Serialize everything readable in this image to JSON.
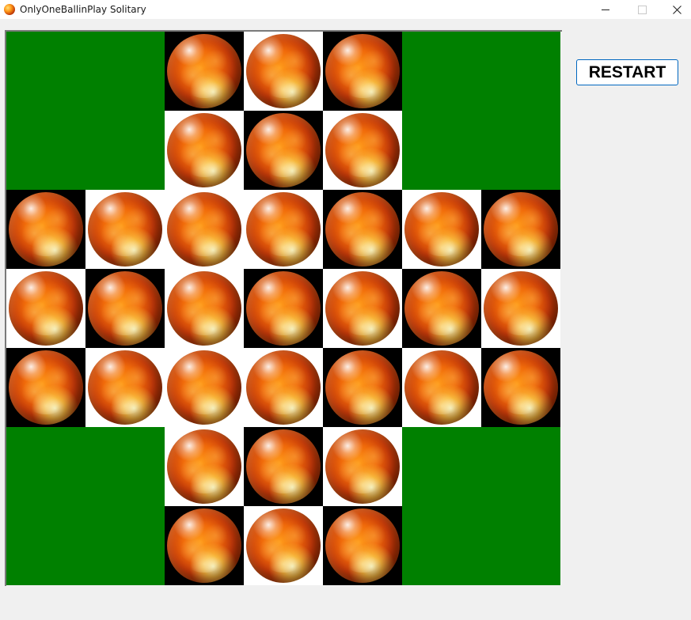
{
  "window": {
    "title": "OnlyOneBallinPlay Solitary",
    "icon": "fire-ball-icon",
    "controls": [
      "minimize-icon",
      "maximize-icon",
      "close-icon"
    ]
  },
  "colors": {
    "board_outside": "#008000",
    "square_light": "#ffffff",
    "square_dark": "#000000",
    "button_border": "#0067c0"
  },
  "board": {
    "rows": [
      [
        "green",
        "green",
        "dark",
        "light",
        "dark",
        "green",
        "green"
      ],
      [
        "green",
        "green",
        "light",
        "dark",
        "light",
        "green",
        "green"
      ],
      [
        "dark",
        "light",
        "light",
        "light",
        "dark",
        "light",
        "dark"
      ],
      [
        "light",
        "dark",
        "light",
        "dark",
        "light",
        "dark",
        "light"
      ],
      [
        "dark",
        "light",
        "light",
        "light",
        "dark",
        "light",
        "dark"
      ],
      [
        "green",
        "green",
        "light",
        "dark",
        "light",
        "green",
        "green"
      ],
      [
        "green",
        "green",
        "dark",
        "light",
        "dark",
        "green",
        "green"
      ]
    ],
    "pegs": [
      [
        0,
        0,
        1,
        1,
        1,
        0,
        0
      ],
      [
        0,
        0,
        1,
        1,
        1,
        0,
        0
      ],
      [
        1,
        1,
        1,
        1,
        1,
        1,
        1
      ],
      [
        1,
        1,
        1,
        1,
        1,
        1,
        1
      ],
      [
        1,
        1,
        1,
        1,
        1,
        1,
        1
      ],
      [
        0,
        0,
        1,
        1,
        1,
        0,
        0
      ],
      [
        0,
        0,
        1,
        1,
        1,
        0,
        0
      ]
    ]
  },
  "restart_button": {
    "label": "RESTART"
  }
}
